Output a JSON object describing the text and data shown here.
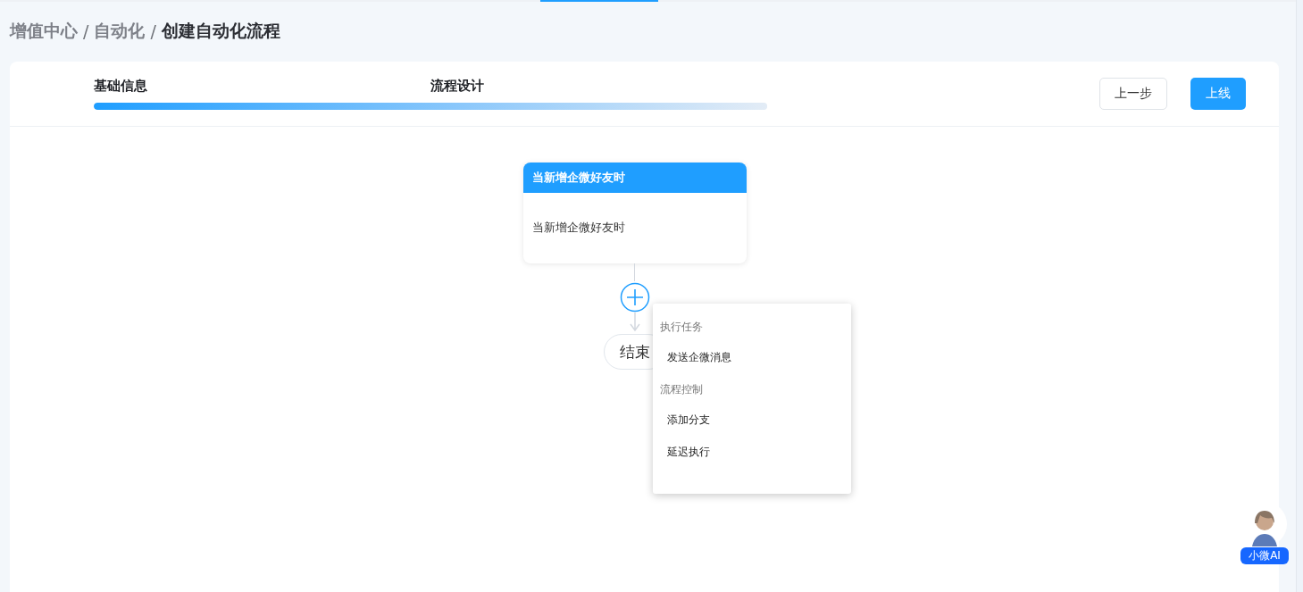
{
  "breadcrumb": [
    {
      "label": "增值中心",
      "current": false
    },
    {
      "label": "/",
      "kind": "sep"
    },
    {
      "label": "自动化",
      "current": false
    },
    {
      "label": "/",
      "kind": "sep"
    },
    {
      "label": "创建自动化流程",
      "current": true
    }
  ],
  "steps": [
    {
      "label": "基础信息"
    },
    {
      "label": "流程设计"
    }
  ],
  "progress": {
    "level": 1
  },
  "buttons": [
    {
      "label": "上一步",
      "kind": "default"
    },
    {
      "label": "上线",
      "kind": "primary"
    }
  ],
  "trigger_node": {
    "title": "当新增企微好友时",
    "body": "当新增企微好友时"
  },
  "end_node": {
    "label": "结束"
  },
  "add_menu": {
    "groups": [
      {
        "title": "执行任务",
        "items": [
          "发送企微消息"
        ]
      },
      {
        "title": "流程控制",
        "items": [
          "添加分支",
          "延迟执行"
        ]
      }
    ]
  },
  "assistant": {
    "label": "小微AI"
  }
}
